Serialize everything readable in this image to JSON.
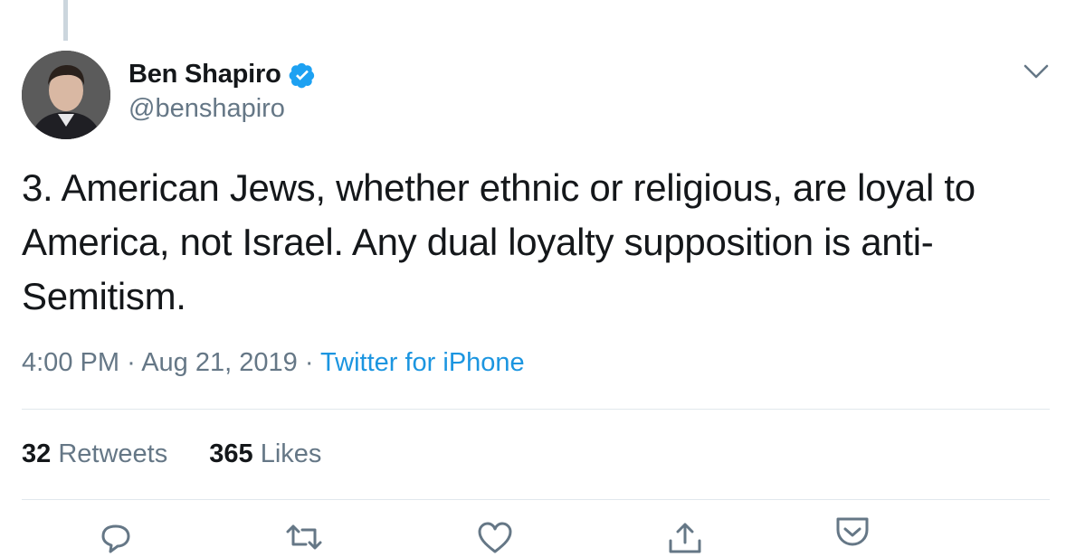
{
  "tweet": {
    "author": {
      "display_name": "Ben Shapiro",
      "handle": "@benshapiro",
      "verified_icon": "verified-badge-icon",
      "avatar": "avatar"
    },
    "text": "3. American Jews, whether ethnic or religious, are loyal to America, not Israel. Any dual loyalty supposition is anti-Semitism.",
    "time": "4:00 PM",
    "separator": "·",
    "date": "Aug 21, 2019",
    "source": "Twitter for iPhone",
    "stats": {
      "retweets_count": "32",
      "retweets_label": "Retweets",
      "likes_count": "365",
      "likes_label": "Likes"
    },
    "actions": [
      "reply-icon",
      "retweet-icon",
      "like-icon",
      "share-icon",
      "save-icon"
    ]
  },
  "colors": {
    "text_primary": "#14171a",
    "text_secondary": "#657786",
    "link": "#1b95e0",
    "verified": "#1da1f2",
    "divider": "#e1e8ed",
    "thread_line": "#ccd6dd"
  }
}
